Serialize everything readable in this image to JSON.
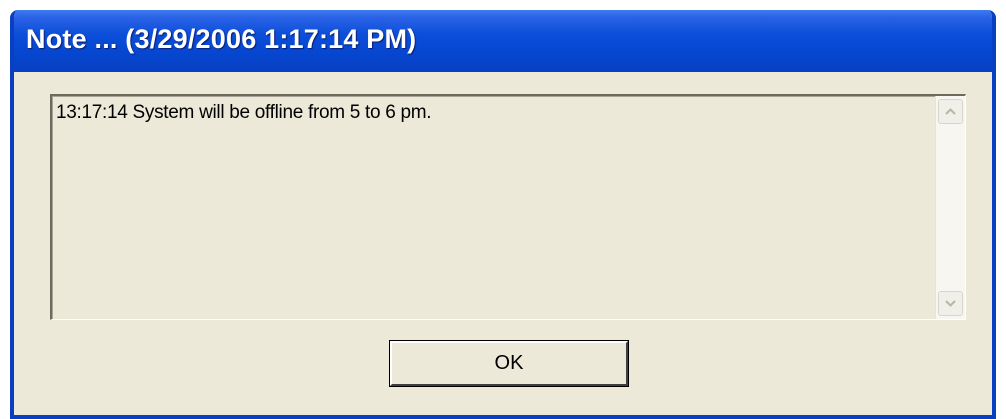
{
  "window": {
    "title": "Note ... (3/29/2006 1:17:14 PM)"
  },
  "message": {
    "text": "13:17:14 System will be offline from 5 to 6 pm."
  },
  "scrollbar": {
    "up_icon": "chevron-up-icon",
    "down_icon": "chevron-down-icon"
  },
  "buttons": {
    "ok_label": "OK"
  },
  "colors": {
    "titlebar": "#0b4ed9",
    "window_bg": "#ece9d8",
    "title_text": "#ffffff"
  }
}
